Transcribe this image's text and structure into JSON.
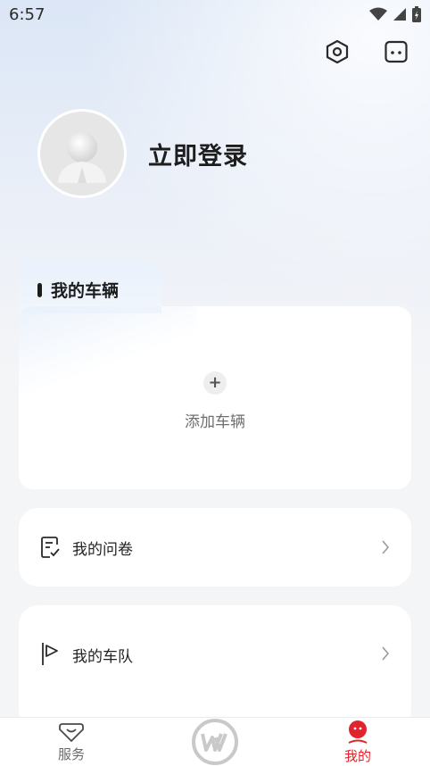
{
  "status_bar": {
    "time": "6:57"
  },
  "profile": {
    "login_label": "立即登录"
  },
  "vehicles": {
    "section_title": "我的车辆",
    "add_label": "添加车辆"
  },
  "menu": [
    {
      "label": "我的问卷",
      "icon": "questionnaire-icon"
    },
    {
      "label": "我的车队",
      "icon": "flag-icon"
    }
  ],
  "tabbar": {
    "items": [
      {
        "label": "服务",
        "icon": "service-icon",
        "active": false
      },
      {
        "label": "",
        "icon": "brand-logo-icon",
        "active": false
      },
      {
        "label": "我的",
        "icon": "mine-icon",
        "active": true
      }
    ]
  },
  "colors": {
    "accent": "#e0232c",
    "card": "#ffffff",
    "background": "#f4f5f7"
  }
}
